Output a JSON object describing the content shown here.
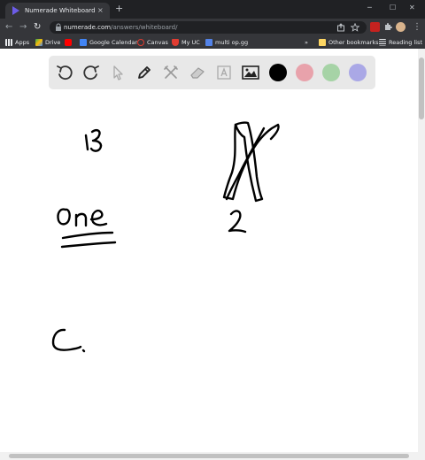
{
  "browser": {
    "tab_title": "Numerade Whiteboard",
    "tab_close": "×",
    "new_tab": "+",
    "url_host": "numerade.com",
    "url_path": "/answers/whiteboard/"
  },
  "bookmarks": {
    "items": [
      "Apps",
      "Drive",
      "Google Calendar",
      "Canvas",
      "My UC",
      "multi op.gg"
    ],
    "more": "»",
    "other": "Other bookmarks",
    "reading_list": "Reading list"
  },
  "whiteboard": {
    "tools": [
      "undo-icon",
      "redo-icon",
      "cursor-icon",
      "pen-icon",
      "tools-icon",
      "eraser-icon",
      "text-icon",
      "image-icon"
    ],
    "colors": [
      "#000000",
      "#e8a2ab",
      "#a6d3a6",
      "#aaa8e6"
    ]
  }
}
